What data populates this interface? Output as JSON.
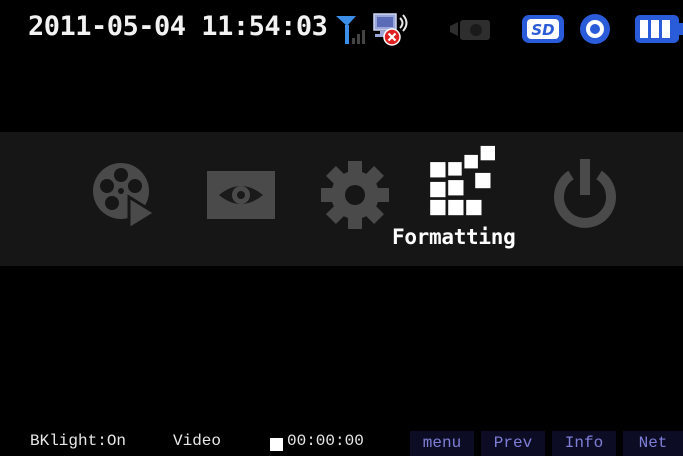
{
  "status": {
    "datetime": "2011-05-04 11:54:03",
    "icons": [
      "signal-antenna-icon",
      "network-disconnected-icon",
      "camera-icon",
      "sd-card-icon",
      "record-indicator-icon",
      "battery-full-icon"
    ],
    "sd_label": "SD"
  },
  "menu": {
    "items": [
      "video-playback-icon",
      "preview-eye-icon",
      "settings-gear-icon",
      "formatting-blocks-icon",
      "power-icon"
    ],
    "selected_label": "Formatting"
  },
  "bottom": {
    "backlight": "BKlight:On",
    "mode": "Video",
    "rec_time": "00:00:00",
    "softkeys": [
      "menu",
      "Prev",
      "Info",
      "Net"
    ]
  },
  "colors": {
    "accent_blue": "#3b6fe8",
    "softkey_text": "#7f7fd8",
    "inactive_icon": "#4a4a4a"
  }
}
